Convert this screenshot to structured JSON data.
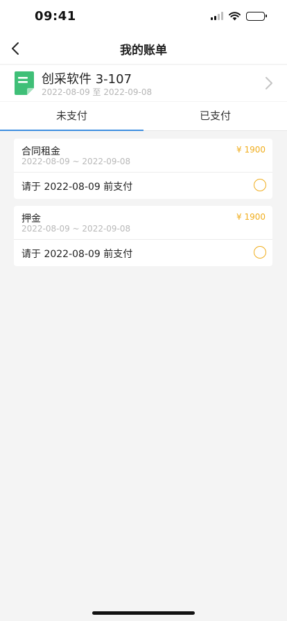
{
  "status_bar": {
    "time": "09:41"
  },
  "nav": {
    "title": "我的账单"
  },
  "property": {
    "name": "创采软件 3-107",
    "date_range": "2022-08-09 至 2022-09-08"
  },
  "tabs": [
    {
      "label": "未支付",
      "active": true
    },
    {
      "label": "已支付",
      "active": false
    }
  ],
  "bills": [
    {
      "name": "合同租金",
      "date_range": "2022-08-09 ~ 2022-09-08",
      "amount": "¥ 1900",
      "due_text": "请于 2022-08-09 前支付"
    },
    {
      "name": "押金",
      "date_range": "2022-08-09 ~ 2022-09-08",
      "amount": "¥ 1900",
      "due_text": "请于 2022-08-09 前支付"
    }
  ],
  "colors": {
    "accent": "#3d8ee0",
    "amount": "#f0ad1c",
    "doc_icon": "#3fbf77"
  },
  "icons": {
    "back": "chevron-left-icon",
    "document": "document-icon",
    "forward": "chevron-right-icon",
    "select": "radio-circle-icon"
  }
}
